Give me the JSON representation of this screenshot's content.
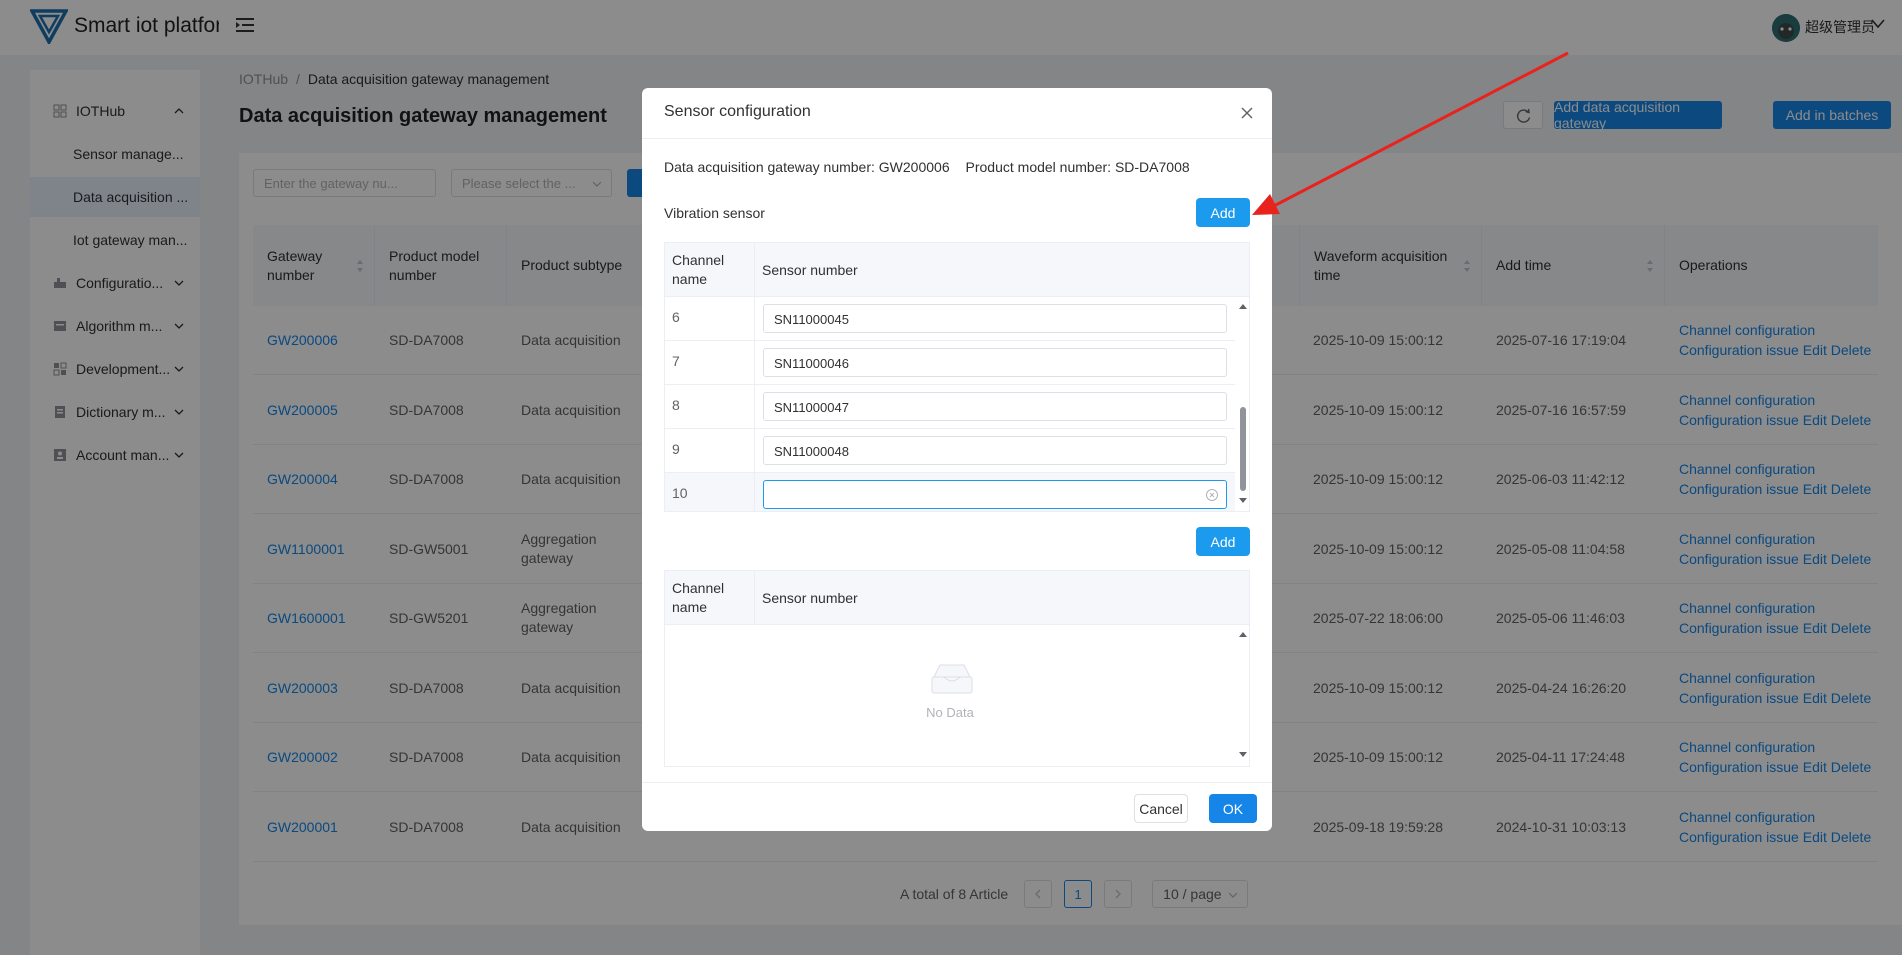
{
  "header": {
    "app_title": "Smart iot platform",
    "user_name": "超级管理员"
  },
  "sidebar": {
    "items": [
      {
        "label": "IOTHub",
        "icon": "grid-icon"
      },
      {
        "label": "Sensor manage..."
      },
      {
        "label": "Data acquisition ..."
      },
      {
        "label": "Iot gateway man..."
      },
      {
        "label": "Configuratio...",
        "icon": "config-icon"
      },
      {
        "label": "Algorithm m...",
        "icon": "algorithm-icon"
      },
      {
        "label": "Development...",
        "icon": "development-icon"
      },
      {
        "label": "Dictionary m...",
        "icon": "dictionary-icon"
      },
      {
        "label": "Account man...",
        "icon": "account-icon"
      }
    ]
  },
  "breadcrumb": {
    "root": "IOTHub",
    "sep": "/",
    "current": "Data acquisition gateway management"
  },
  "page": {
    "title": "Data acquisition gateway management",
    "add_gateway_label": "Add data acquisition gateway",
    "add_batch_label": "Add in batches",
    "search_placeholder": "Enter the gateway nu...",
    "select_placeholder": "Please select the ..."
  },
  "table": {
    "headers": {
      "gateway_number": "Gateway number",
      "product_model": "Product model number",
      "product_subtype": "Product subtype",
      "waveform_time": "Waveform acquisition time",
      "add_time": "Add time",
      "operations": "Operations"
    },
    "ops": {
      "channel_config": "Channel configuration",
      "config_issue": "Configuration issue",
      "edit": "Edit",
      "delete": "Delete"
    },
    "rows": [
      {
        "gateway": "GW200006",
        "model": "SD-DA7008",
        "subtype": "Data acquisition",
        "waveform": "2025-10-09 15:00:12",
        "added": "2025-07-16 17:19:04"
      },
      {
        "gateway": "GW200005",
        "model": "SD-DA7008",
        "subtype": "Data acquisition",
        "waveform": "2025-10-09 15:00:12",
        "added": "2025-07-16 16:57:59"
      },
      {
        "gateway": "GW200004",
        "model": "SD-DA7008",
        "subtype": "Data acquisition",
        "waveform": "2025-10-09 15:00:12",
        "added": "2025-06-03 11:42:12"
      },
      {
        "gateway": "GW1100001",
        "model": "SD-GW5001",
        "subtype": "Aggregation gateway",
        "waveform": "2025-10-09 15:00:12",
        "added": "2025-05-08 11:04:58"
      },
      {
        "gateway": "GW1600001",
        "model": "SD-GW5201",
        "subtype": "Aggregation gateway",
        "waveform": "2025-07-22 18:06:00",
        "added": "2025-05-06 11:46:03"
      },
      {
        "gateway": "GW200003",
        "model": "SD-DA7008",
        "subtype": "Data acquisition",
        "waveform": "2025-10-09 15:00:12",
        "added": "2025-04-24 16:26:20"
      },
      {
        "gateway": "GW200002",
        "model": "SD-DA7008",
        "subtype": "Data acquisition",
        "waveform": "2025-10-09 15:00:12",
        "added": "2025-04-11 17:24:48"
      },
      {
        "gateway": "GW200001",
        "model": "SD-DA7008",
        "subtype": "Data acquisition",
        "waveform": "2025-09-18 19:59:28",
        "added": "2024-10-31 10:03:13"
      }
    ]
  },
  "pagination": {
    "total": "A total of 8 Article",
    "current_page": "1",
    "page_size": "10 / page"
  },
  "modal": {
    "title": "Sensor configuration",
    "gateway_label": "Data acquisition gateway number:",
    "gateway_value": "GW200006",
    "model_label": "Product model number:",
    "model_value": "SD-DA7008",
    "section_label": "Vibration sensor",
    "add_label": "Add",
    "col_channel": "Channel name",
    "col_sensor": "Sensor number",
    "rows": [
      {
        "channel": "6",
        "sensor": "SN11000045"
      },
      {
        "channel": "7",
        "sensor": "SN11000046"
      },
      {
        "channel": "8",
        "sensor": "SN11000047"
      },
      {
        "channel": "9",
        "sensor": "SN11000048"
      },
      {
        "channel": "10",
        "sensor": ""
      }
    ],
    "empty_text": "No Data",
    "cancel_label": "Cancel",
    "ok_label": "OK"
  },
  "colors": {
    "primary": "#1586e8",
    "modal_add": "#1b9aee",
    "annotation_arrow": "#e8231e"
  }
}
